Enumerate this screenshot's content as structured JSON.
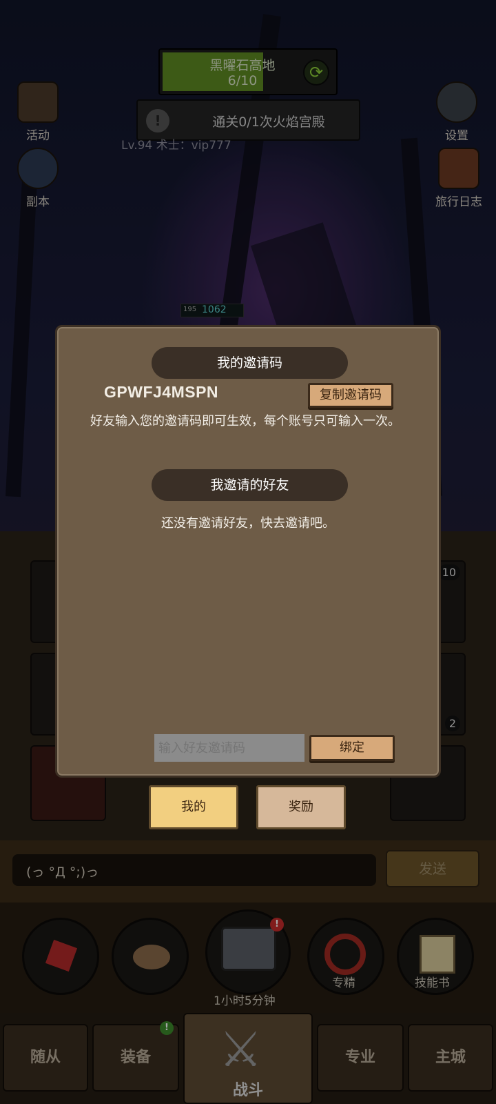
{
  "hud": {
    "stage_name": "黑曜石高地",
    "stage_progress": "6/10",
    "quest_text": "通关0/1次火焰宫殿",
    "player_info": "Lv.94 术士：vip777",
    "hp_level": "195",
    "hp_value": "1062"
  },
  "side_buttons": {
    "activity": "活动",
    "dungeon": "副本",
    "settings": "设置",
    "travel_log": "旅行日志"
  },
  "slots": {
    "badge_a": "10",
    "badge_b": "2"
  },
  "dialog": {
    "my_code_header": "我的邀请码",
    "invite_code": "GPWFJ4MSPN",
    "copy_button": "复制邀请码",
    "hint": "好友输入您的邀请码即可生效，每个账号只可输入一次。",
    "friends_header": "我邀请的好友",
    "empty_friends": "还没有邀请好友，快去邀请吧。",
    "input_placeholder": "输入好友邀请码",
    "bind_button": "绑定"
  },
  "tabs": {
    "mine": "我的",
    "rewards": "奖励"
  },
  "chat": {
    "message": "(っ °Д °;)っ",
    "send": "发送"
  },
  "actions": {
    "chest_timer": "1小时5分钟",
    "specialize": "专精",
    "skill_book": "技能书"
  },
  "nav": {
    "followers": "随从",
    "equipment": "装备",
    "battle": "战斗",
    "profession": "专业",
    "main_city": "主城"
  },
  "colors": {
    "dialog_bg": "#6e5c47",
    "tab_active": "#f2cf80",
    "tab_inactive": "#d6b89a",
    "wood_button": "#d7a97a",
    "stage_fill": "#5f8a23"
  }
}
